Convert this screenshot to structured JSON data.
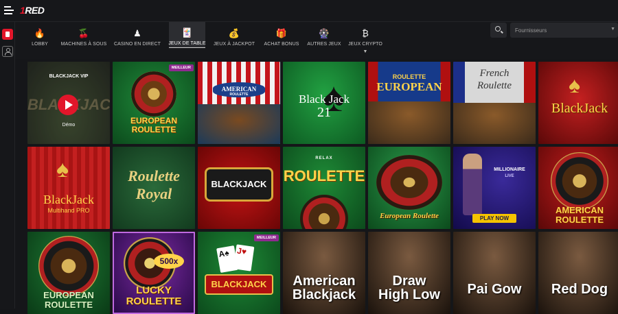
{
  "app": {
    "logo_number": "1",
    "logo_text": "RED"
  },
  "categories": [
    {
      "label": "LOBBY",
      "icon": "🔥"
    },
    {
      "label": "MACHINES À SOUS",
      "icon": "🍒"
    },
    {
      "label": "CASINO EN DIRECT",
      "icon": "♟"
    },
    {
      "label": "JEUX DE TABLE",
      "icon": "🃏",
      "active": true
    },
    {
      "label": "JEUX À JACKPOT",
      "icon": "💰"
    },
    {
      "label": "ACHAT BONUS",
      "icon": "🎁"
    },
    {
      "label": "AUTRES JEUX",
      "icon": "🎡"
    },
    {
      "label": "JEUX CRYPTO",
      "icon": "₿",
      "has_dropdown": true
    }
  ],
  "providers": {
    "placeholder": "Fournisseurs"
  },
  "games": [
    {
      "title": "BLACKJACK VIP",
      "subtitle": "BLACKJACK",
      "demo_label": "Démo",
      "hovered": true
    },
    {
      "title": "EUROPEAN",
      "subtitle": "ROULETTE",
      "badge": "MEILLEUR"
    },
    {
      "title": "AMERICAN",
      "subtitle": "ROULETTE"
    },
    {
      "title": "Black Jack",
      "subtitle": "21"
    },
    {
      "title": "ROULETTE",
      "subtitle": "EUROPEAN"
    },
    {
      "title": "French",
      "subtitle": "Roulette"
    },
    {
      "title": "BlackJack",
      "subtitle": ""
    },
    {
      "title": "BlackJack",
      "subtitle": "Multihand PRO"
    },
    {
      "title": "Roulette",
      "subtitle": "Royal"
    },
    {
      "title": "BLACKJACK",
      "subtitle": ""
    },
    {
      "title": "ROULETTE",
      "subtitle": "RELAX"
    },
    {
      "title": "European Roulette",
      "subtitle": ""
    },
    {
      "title": "MILLIONAIRE",
      "subtitle": "LIVE",
      "cta": "PLAY NOW"
    },
    {
      "title": "AMERICAN",
      "subtitle": "ROULETTE"
    },
    {
      "title": "EUROPEAN",
      "subtitle": "ROULETTE"
    },
    {
      "title": "LUCKY",
      "subtitle": "ROULETTE",
      "multiplier": "500x"
    },
    {
      "title": "BLACKJACK",
      "subtitle": "",
      "badge": "MEILLEUR"
    },
    {
      "title": "American",
      "subtitle": "Blackjack"
    },
    {
      "title": "Draw",
      "subtitle": "High Low"
    },
    {
      "title": "Pai Gow",
      "subtitle": ""
    },
    {
      "title": "Red Dog",
      "subtitle": ""
    }
  ]
}
